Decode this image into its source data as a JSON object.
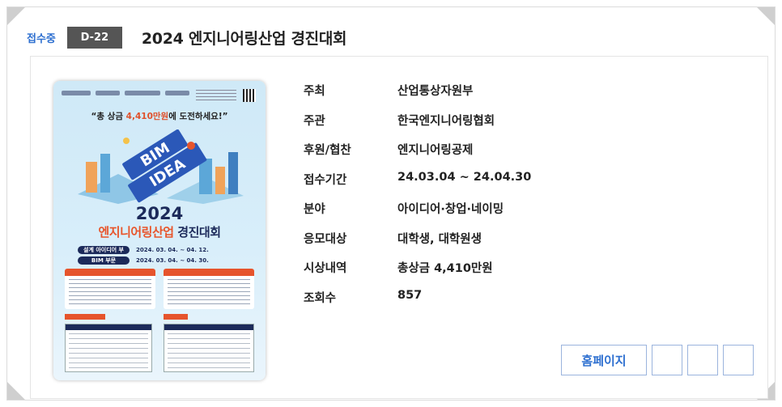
{
  "header": {
    "status": "접수중",
    "dday": "D-22",
    "title": "2024 엔지니어링산업 경진대회"
  },
  "poster": {
    "slogan_prefix": "“총 상금 ",
    "slogan_amount": "4,410만원",
    "slogan_suffix": "에 도전하세요!”",
    "year": "2024",
    "name_main": "엔지니어링산업",
    "name_tail": " 경진대회",
    "row1_pill": "설계 아이디어 부문",
    "row1_dates": "2024. 03. 04. ~ 04. 12.",
    "row2_pill": "BIM 부문",
    "row2_dates": "2024. 03. 04. ~ 04. 30."
  },
  "details": [
    {
      "label": "주최",
      "value": "산업통상자원부"
    },
    {
      "label": "주관",
      "value": "한국엔지니어링협회"
    },
    {
      "label": "후원/협찬",
      "value": "엔지니어링공제"
    },
    {
      "label": "접수기간",
      "value": "24.03.04 ~ 24.04.30"
    },
    {
      "label": "분야",
      "value": "아이디어·창업·네이밍"
    },
    {
      "label": "응모대상",
      "value": "대학생, 대학원생"
    },
    {
      "label": "시상내역",
      "value": "총상금 4,410만원"
    },
    {
      "label": "조회수",
      "value": "857"
    }
  ],
  "actions": {
    "homepage_label": "홈페이지"
  },
  "colors": {
    "accent": "#2d6fd0",
    "badge_bg": "#555555",
    "poster_orange": "#e8552b",
    "poster_navy": "#1c2a5a"
  }
}
